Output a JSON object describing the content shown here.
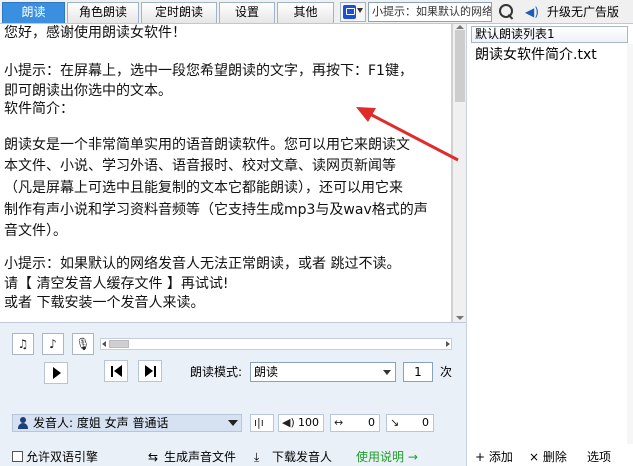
{
  "tabs": [
    {
      "label": "朗读",
      "active": true
    },
    {
      "label": "角色朗读",
      "active": false
    },
    {
      "label": "定时朗读",
      "active": false
    },
    {
      "label": "设置",
      "active": false
    },
    {
      "label": "其他",
      "active": false
    }
  ],
  "search": {
    "value": "小提示：如果默认的网络"
  },
  "upgrade_label": "升级无广告版",
  "text_lines": [
    "您好，感谢使用朗读女软件！",
    "",
    "小提示：在屏幕上，选中一段您希望朗读的文字，再按下：F1键，",
    "                    即可朗读出你选中的文本。",
    "软件简介：",
    "",
    "朗读女是一个非常简单实用的语音朗读软件。您可以用它来朗读文",
    "本文件、小说、学习外语、语音报时、校对文章、读网页新闻等",
    "（凡是屏幕上可选中且能复制的文本它都能朗读），还可以用它来",
    "制作有声小说和学习资料音频等（它支持生成mp3与及wav格式的声",
    "音文件）。",
    "",
    "小提示：如果默认的网络发音人无法正常朗读，或者 跳过不读。",
    "          请【 清空发音人缓存文件 】再试试!",
    "              或者 下载安装一个发音人来读。"
  ],
  "playlist": {
    "header": "默认朗读列表1",
    "items": [
      "朗读女软件简介.txt"
    ],
    "footer": {
      "add": "+ 添加",
      "delete": "× 删除",
      "options": "选项"
    }
  },
  "controls": {
    "mode_label": "朗读模式:",
    "mode_value": "朗读",
    "times_value": "1",
    "times_label": "次",
    "speaker_label": "发音人: 度姐 女声 普通话",
    "volume": "100",
    "speed": "0",
    "pitch": "0",
    "bilingual_label": "允许双语引擎",
    "gen_audio_label": "生成声音文件",
    "download_speaker_label": "下载发音人",
    "help_label": "使用说明 →"
  },
  "colors": {
    "active_tab": "#3b8fe0",
    "arrow": "#e02b2b",
    "help_link": "#1f9d2a"
  }
}
